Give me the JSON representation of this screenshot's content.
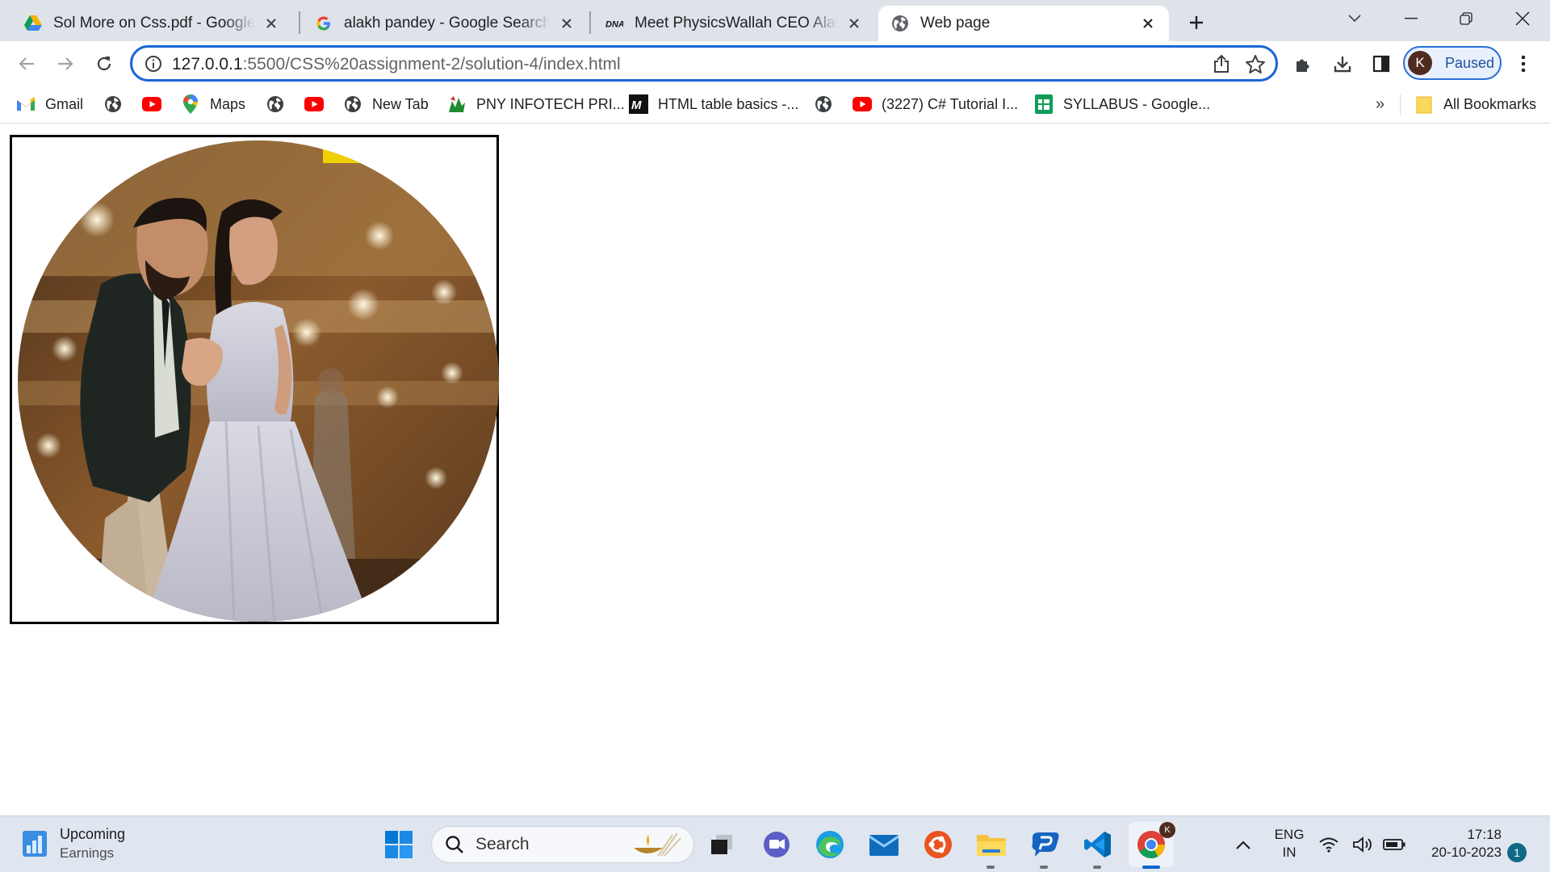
{
  "browser": {
    "tabs": [
      {
        "title": "Sol More on Css.pdf - Google Drive",
        "icon": "google-drive-icon",
        "active": false
      },
      {
        "title": "alakh pandey - Google Search",
        "icon": "google-icon",
        "active": false
      },
      {
        "title": "Meet PhysicsWallah CEO Alakh Pandey",
        "icon": "dna-icon",
        "active": false
      },
      {
        "title": "Web page",
        "icon": "globe-icon",
        "active": true
      }
    ],
    "address": {
      "host": "127.0.0.1",
      "path": ":5500/CSS%20assignment-2/solution-4/index.html"
    },
    "profile": {
      "initial": "K",
      "status": "Paused"
    },
    "bookmarks": [
      {
        "label": "Gmail",
        "icon": "gmail-icon"
      },
      {
        "label": "",
        "icon": "globe-icon"
      },
      {
        "label": "",
        "icon": "youtube-icon"
      },
      {
        "label": "Maps",
        "icon": "maps-icon"
      },
      {
        "label": "",
        "icon": "globe-icon"
      },
      {
        "label": "",
        "icon": "youtube-icon"
      },
      {
        "label": "New Tab",
        "icon": "globe-icon"
      },
      {
        "label": "PNY INFOTECH PRI...",
        "icon": "pny-icon"
      },
      {
        "label": "HTML table basics -...",
        "icon": "mdn-icon"
      },
      {
        "label": "",
        "icon": "globe-icon"
      },
      {
        "label": "(3227) C# Tutorial I...",
        "icon": "youtube-icon"
      },
      {
        "label": "SYLLABUS - Google...",
        "icon": "sheets-icon"
      }
    ],
    "bookmarks_more": "»",
    "all_bookmarks": "All Bookmarks"
  },
  "page": {
    "image": {
      "description_icon": "circular-couple-photo",
      "border_color": "#000000"
    }
  },
  "taskbar": {
    "weather": {
      "line1": "Upcoming",
      "line2": "Earnings"
    },
    "search_label": "Search",
    "apps": [
      "windows-start-icon",
      "search-icon",
      "task-view-icon",
      "teams-chat-icon",
      "edge-icon",
      "mail-icon",
      "ubuntu-icon",
      "file-explorer-icon",
      "vpn-app-icon",
      "vscode-icon",
      "chrome-icon"
    ],
    "lang": {
      "line1": "ENG",
      "line2": "IN"
    },
    "clock": {
      "time": "17:18",
      "date": "20-10-2023"
    },
    "notifications": "1"
  },
  "colors": {
    "accent": "#1a66d6",
    "tabstrip": "#dee3ea",
    "taskbar": "#dfe6f0"
  }
}
